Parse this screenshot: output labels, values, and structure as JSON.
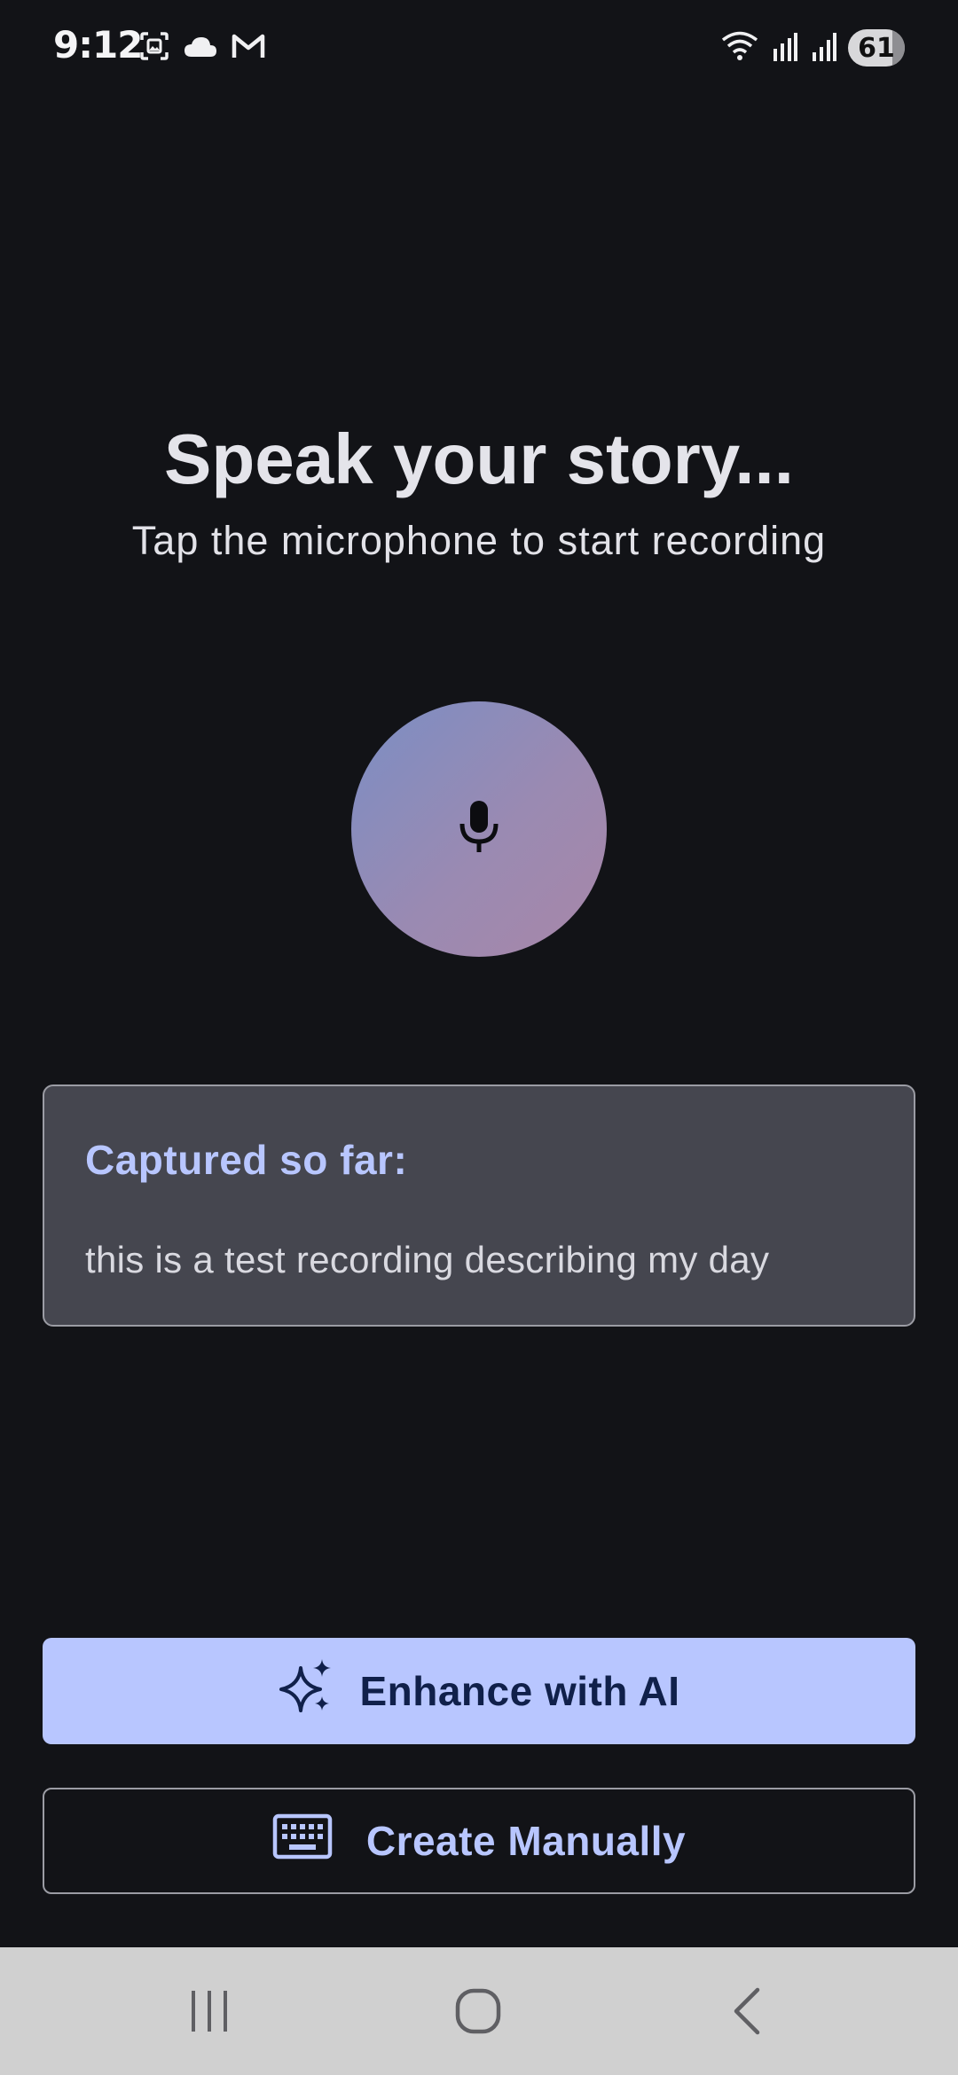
{
  "status_bar": {
    "time": "9:12",
    "battery": "61",
    "left_icons": [
      "screenshot-icon",
      "cloud-icon",
      "gmail-icon"
    ],
    "right_icons": [
      "wifi-icon",
      "signal-r-icon",
      "signal-icon",
      "battery-icon"
    ]
  },
  "main": {
    "title": "Speak your story...",
    "subtitle": "Tap the microphone to start recording",
    "mic_icon": "microphone-icon"
  },
  "transcript": {
    "heading": "Captured so far:",
    "text": "this is a test recording describing my day"
  },
  "actions": {
    "enhance_label": "Enhance with AI",
    "enhance_icon": "sparkle-icon",
    "manual_label": "Create Manually",
    "manual_icon": "keyboard-icon"
  },
  "nav": {
    "items": [
      "recents-icon",
      "home-icon",
      "back-icon"
    ]
  },
  "colors": {
    "background": "#121317",
    "accent": "#b8c6ff",
    "card": "#45464f",
    "nav_bar": "#d0d0d0"
  }
}
